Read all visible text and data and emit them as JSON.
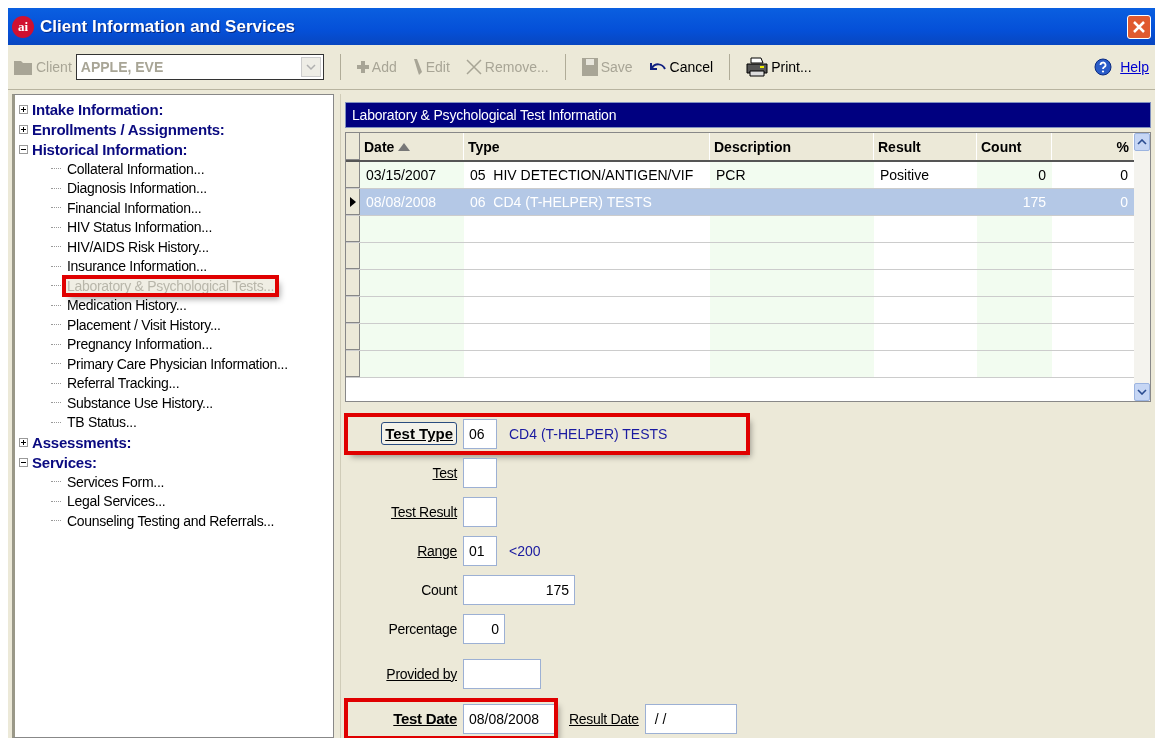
{
  "window": {
    "title": "Client Information and Services",
    "logo": "ai"
  },
  "toolbar": {
    "client_label": "Client",
    "client_value": "APPLE, EVE",
    "buttons": [
      {
        "label": "Add",
        "disabled": true
      },
      {
        "label": "Edit",
        "disabled": true
      },
      {
        "label": "Remove...",
        "disabled": true
      },
      {
        "label": "Save",
        "disabled": true
      },
      {
        "label": "Cancel",
        "disabled": false
      },
      {
        "label": "Print...",
        "disabled": false
      }
    ],
    "help": "Help"
  },
  "tree": [
    {
      "label": "Intake Information:",
      "expanded": false
    },
    {
      "label": "Enrollments / Assignments:",
      "expanded": false
    },
    {
      "label": "Historical Information:",
      "expanded": true,
      "children": [
        {
          "label": "Collateral Information...",
          "selected": false,
          "highlighted": false
        },
        {
          "label": "Diagnosis Information...",
          "selected": false,
          "highlighted": false
        },
        {
          "label": "Financial Information...",
          "selected": false,
          "highlighted": false
        },
        {
          "label": "HIV Status Information...",
          "selected": false,
          "highlighted": false
        },
        {
          "label": "HIV/AIDS Risk History...",
          "selected": false,
          "highlighted": false
        },
        {
          "label": "Insurance Information...",
          "selected": false,
          "highlighted": false
        },
        {
          "label": "Laboratory & Psychological Tests...",
          "selected": true,
          "highlighted": true
        },
        {
          "label": "Medication History...",
          "selected": false,
          "highlighted": false
        },
        {
          "label": "Placement / Visit History...",
          "selected": false,
          "highlighted": false
        },
        {
          "label": "Pregnancy Information...",
          "selected": false,
          "highlighted": false
        },
        {
          "label": "Primary Care Physician Information...",
          "selected": false,
          "highlighted": false
        },
        {
          "label": "Referral Tracking...",
          "selected": false,
          "highlighted": false
        },
        {
          "label": "Substance Use History...",
          "selected": false,
          "highlighted": false
        },
        {
          "label": "TB Status...",
          "selected": false,
          "highlighted": false
        }
      ]
    },
    {
      "label": "Assessments:",
      "expanded": false
    },
    {
      "label": "Services:",
      "expanded": true,
      "children": [
        {
          "label": "Services Form...",
          "selected": false,
          "highlighted": false
        },
        {
          "label": "Legal Services...",
          "selected": false,
          "highlighted": false
        },
        {
          "label": "Counseling Testing and Referrals...",
          "selected": false,
          "highlighted": false
        }
      ]
    }
  ],
  "grid": {
    "title": "Laboratory & Psychological Test Information",
    "columns": [
      {
        "label": "Date",
        "sorted": true
      },
      {
        "label": "Type",
        "sorted": false
      },
      {
        "label": "Description",
        "sorted": false
      },
      {
        "label": "Result",
        "sorted": false
      },
      {
        "label": "Count",
        "sorted": false
      },
      {
        "label": "%",
        "sorted": false
      }
    ],
    "rows": [
      {
        "cells": [
          "03/15/2007",
          "05  HIV DETECTION/ANTIGEN/VIF",
          "PCR",
          "Positive",
          "0",
          "0"
        ],
        "selected": false
      },
      {
        "cells": [
          "08/08/2008",
          "06  CD4 (T-HELPER) TESTS",
          "",
          "",
          "175",
          "0"
        ],
        "selected": true
      }
    ]
  },
  "form": {
    "rows": [
      {
        "highlighted": true,
        "fields": [
          {
            "label": {
              "kind": "button",
              "text": "Test Type"
            },
            "input": {
              "kind": "code",
              "value": "06"
            },
            "note": "CD4 (T-HELPER) TESTS"
          }
        ]
      },
      {
        "highlighted": false,
        "fields": [
          {
            "label": {
              "kind": "link",
              "text": "Test"
            },
            "input": {
              "kind": "code"
            }
          }
        ]
      },
      {
        "highlighted": false,
        "fields": [
          {
            "label": {
              "kind": "link",
              "text": "Test Result"
            },
            "input": {
              "kind": "code"
            }
          }
        ]
      },
      {
        "highlighted": false,
        "fields": [
          {
            "label": {
              "kind": "link",
              "text": "Range"
            },
            "input": {
              "kind": "code",
              "value": "01"
            },
            "note": "<200"
          }
        ]
      },
      {
        "highlighted": false,
        "fields": [
          {
            "label": {
              "kind": "plain",
              "text": "Count"
            },
            "input": {
              "kind": "number",
              "value": "175"
            }
          }
        ]
      },
      {
        "highlighted": false,
        "fields": [
          {
            "label": {
              "kind": "plain",
              "text": "Percentage"
            },
            "input": {
              "kind": "percent",
              "value": "0"
            }
          }
        ]
      },
      {
        "highlighted": false,
        "fields": [
          {
            "label": {
              "kind": "link",
              "text": "Provided by"
            },
            "input": {
              "kind": "text"
            }
          }
        ]
      },
      {
        "highlighted": true,
        "fields": [
          {
            "label": {
              "kind": "bold",
              "text": "Test Date"
            },
            "input": {
              "kind": "date",
              "value": "08/08/2008"
            }
          },
          {
            "label": {
              "kind": "link",
              "text": "Result Date"
            },
            "input": {
              "kind": "date",
              "value": " / /"
            }
          }
        ]
      }
    ]
  }
}
